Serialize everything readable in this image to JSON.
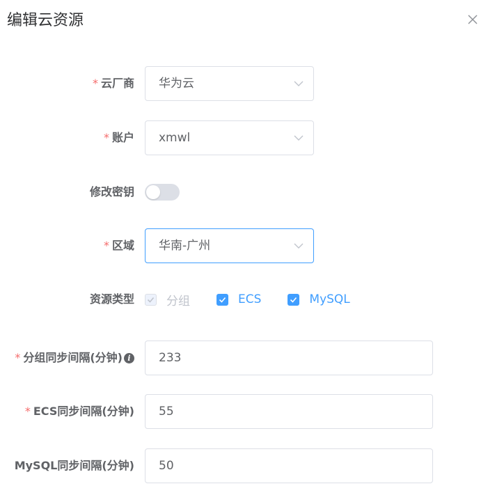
{
  "dialog": {
    "title": "编辑云资源"
  },
  "fields": {
    "cloud_vendor": {
      "label": "云厂商",
      "value": "华为云"
    },
    "account": {
      "label": "账户",
      "value": "xmwl"
    },
    "modify_key": {
      "label": "修改密钥",
      "enabled": false
    },
    "region": {
      "label": "区域",
      "value": "华南-广州"
    },
    "resource_type": {
      "label": "资源类型",
      "options": [
        {
          "label": "分组",
          "checked": true,
          "disabled": true
        },
        {
          "label": "ECS",
          "checked": true,
          "disabled": false
        },
        {
          "label": "MySQL",
          "checked": true,
          "disabled": false
        }
      ]
    },
    "group_sync_interval": {
      "label": "分组同步间隔(分钟)",
      "value": "233",
      "info_icon": "info-icon"
    },
    "ecs_sync_interval": {
      "label": "ECS同步间隔(分钟)",
      "value": "55"
    },
    "mysql_sync_interval": {
      "label": "MySQL同步间隔(分钟)",
      "value": "50"
    }
  },
  "required_mark": "*",
  "colors": {
    "primary": "#409eff",
    "required": "#f56c6c",
    "border": "#dcdfe6",
    "text": "#606266"
  }
}
